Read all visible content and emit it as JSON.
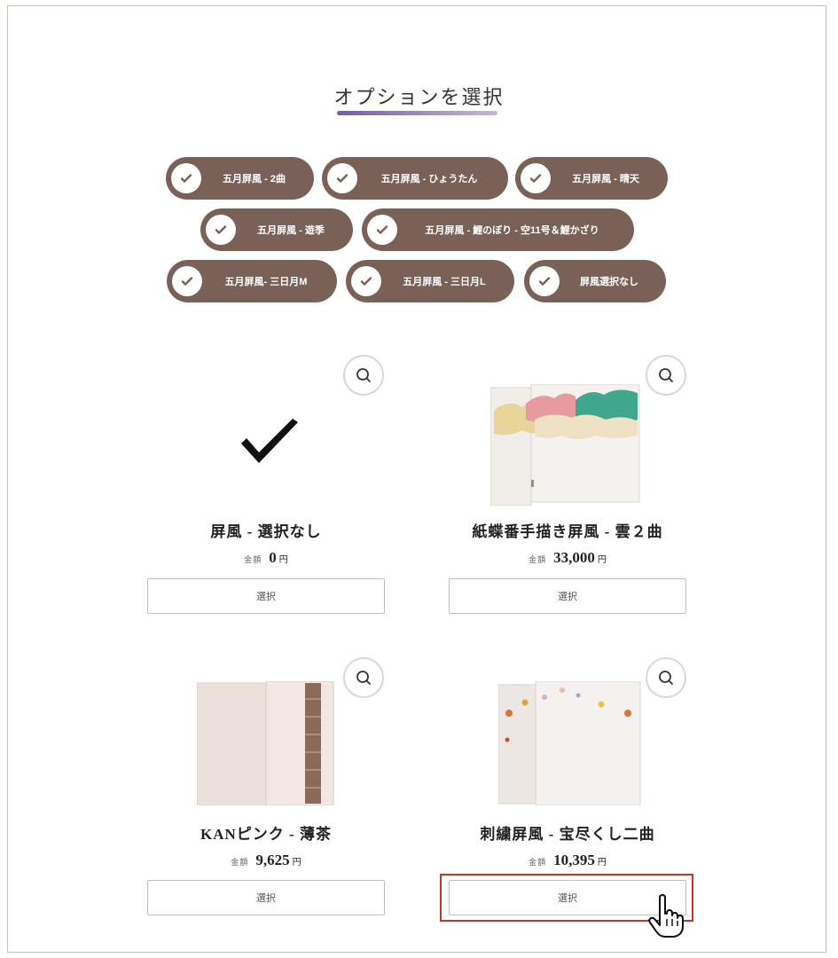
{
  "page": {
    "title": "オプションを選択"
  },
  "chips": [
    {
      "label": "五月屏風 - 2曲"
    },
    {
      "label": "五月屏風 - ひょうたん"
    },
    {
      "label": "五月屏風 - 晴天"
    },
    {
      "label": "五月屏風 - 遊季"
    },
    {
      "label": "五月屏風 - 鯉のぼり - 空11号＆鯉かざり"
    },
    {
      "label": "五月屏風- 三日月M"
    },
    {
      "label": "五月屏風 - 三日月L"
    },
    {
      "label": "屏風選択なし"
    }
  ],
  "products": [
    {
      "name": "屏風 - 選択なし",
      "price_label": "金額",
      "price": "0",
      "unit": "円",
      "button": "選択"
    },
    {
      "name": "紙蝶番手描き屏風 - 雲２曲",
      "price_label": "金額",
      "price": "33,000",
      "unit": "円",
      "button": "選択"
    },
    {
      "name": "KANピンク - 薄茶",
      "price_label": "金額",
      "price": "9,625",
      "unit": "円",
      "button": "選択"
    },
    {
      "name": "刺繍屏風 - 宝尽くし二曲",
      "price_label": "金額",
      "price": "10,395",
      "unit": "円",
      "button": "選択"
    }
  ],
  "icons": {
    "chip_check": "check-icon",
    "zoom": "magnifier-icon",
    "cursor": "hand-pointer-icon"
  },
  "colors": {
    "chip_bg": "#7a6158",
    "accent_purple": "#7a5aa8",
    "highlight": "#c0392b"
  }
}
